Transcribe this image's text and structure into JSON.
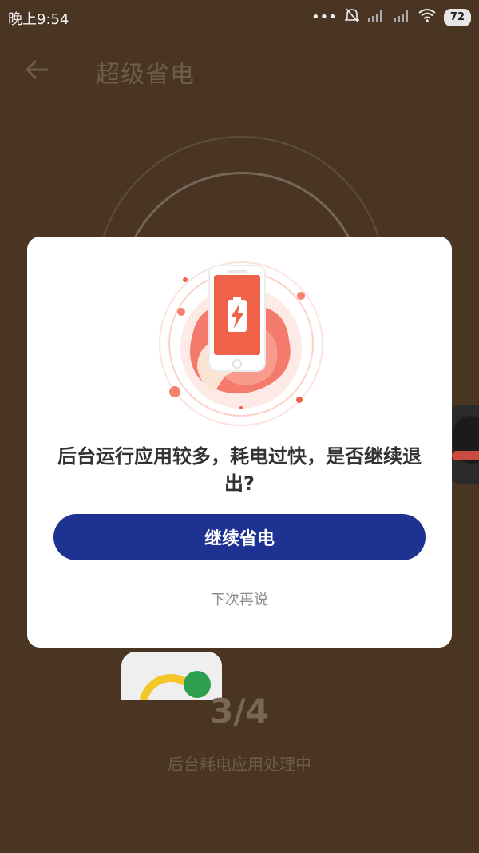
{
  "status_bar": {
    "time": "晚上9:54",
    "battery": "72"
  },
  "header": {
    "title": "超级省电"
  },
  "progress": {
    "count": "3/4",
    "status": "后台耗电应用处理中"
  },
  "dialog": {
    "message": "后台运行应用较多，耗电过快，是否继续退出?",
    "primary_button": "继续省电",
    "secondary_link": "下次再说"
  },
  "colors": {
    "background": "#4a3523",
    "primary_button": "#1e3391",
    "illustration_accent": "#f0614a"
  }
}
